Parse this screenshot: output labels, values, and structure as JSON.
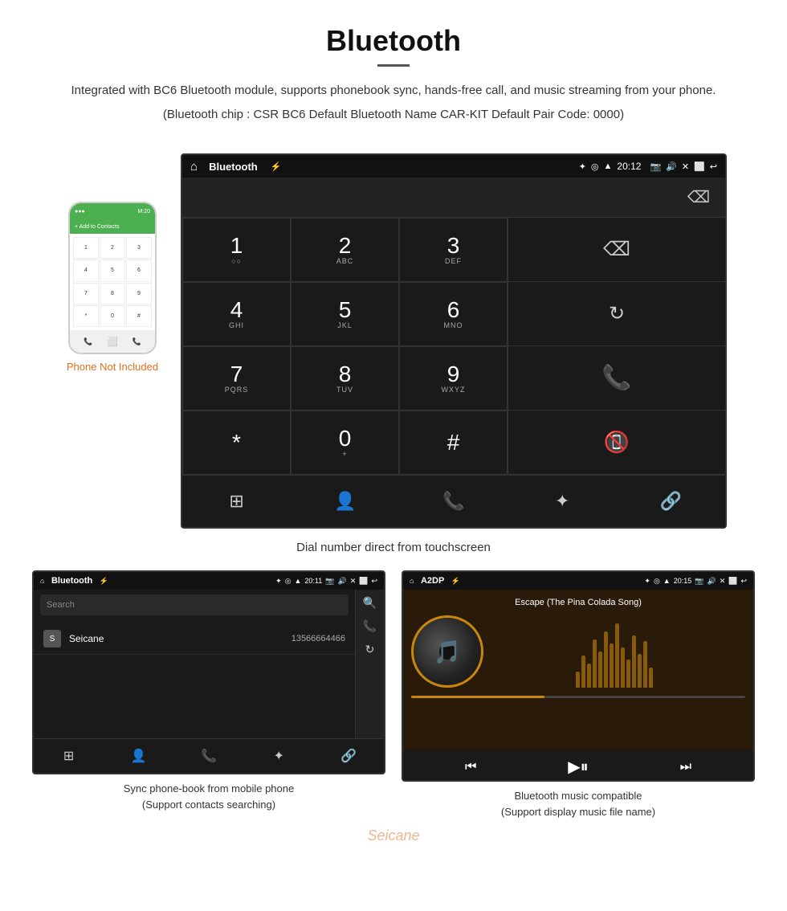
{
  "header": {
    "title": "Bluetooth",
    "description": "Integrated with BC6 Bluetooth module, supports phonebook sync, hands-free call, and music streaming from your phone.",
    "specs": "(Bluetooth chip : CSR BC6   Default Bluetooth Name CAR-KIT    Default Pair Code: 0000)"
  },
  "main_screen": {
    "status_bar": {
      "left_icon": "🏠",
      "center_label": "Bluetooth",
      "usb_icon": "⚡",
      "time": "20:12",
      "bluetooth_icon": "✦",
      "location_icon": "◎",
      "signal_icon": "▲",
      "camera_icon": "📷",
      "volume_icon": "🔊",
      "close_icon": "✕",
      "window_icon": "⬜",
      "back_icon": "↩"
    },
    "dialpad": {
      "keys": [
        {
          "digit": "1",
          "sub": "○○"
        },
        {
          "digit": "2",
          "sub": "ABC"
        },
        {
          "digit": "3",
          "sub": "DEF"
        },
        {
          "digit": "4",
          "sub": "GHI"
        },
        {
          "digit": "5",
          "sub": "JKL"
        },
        {
          "digit": "6",
          "sub": "MNO"
        },
        {
          "digit": "7",
          "sub": "PQRS"
        },
        {
          "digit": "8",
          "sub": "TUV"
        },
        {
          "digit": "9",
          "sub": "WXYZ"
        },
        {
          "digit": "*",
          "sub": ""
        },
        {
          "digit": "0",
          "sub": "+"
        },
        {
          "digit": "#",
          "sub": ""
        }
      ]
    },
    "bottom_icons": [
      "⊞",
      "👤",
      "📞",
      "✦",
      "🔗"
    ]
  },
  "main_caption": "Dial number direct from touchscreen",
  "phone_label": "Phone Not Included",
  "bottom_screens": {
    "left": {
      "status": {
        "left": "🏠 Bluetooth ⚡",
        "right": "✦ ◎ ▲ 20:11 📷 🔊 ✕ ⬜ ↩"
      },
      "search_placeholder": "Search",
      "contacts": [
        {
          "letter": "S",
          "name": "Seicane",
          "number": "13566664466"
        }
      ],
      "bottom_icons": [
        "⊞",
        "👤",
        "📞",
        "✦",
        "🔗"
      ],
      "caption_line1": "Sync phone-book from mobile phone",
      "caption_line2": "(Support contacts searching)"
    },
    "right": {
      "status": {
        "left": "🏠 A2DP ⚡",
        "right": "✦ ◎ ▲ 20:15 📷 🔊 ✕ ⬜ ↩"
      },
      "song_title": "Escape (The Pina Colada Song)",
      "bottom_icons": [
        "⏮",
        "⏭",
        "▶⏸",
        "⏭"
      ],
      "caption_line1": "Bluetooth music compatible",
      "caption_line2": "(Support display music file name)"
    }
  }
}
